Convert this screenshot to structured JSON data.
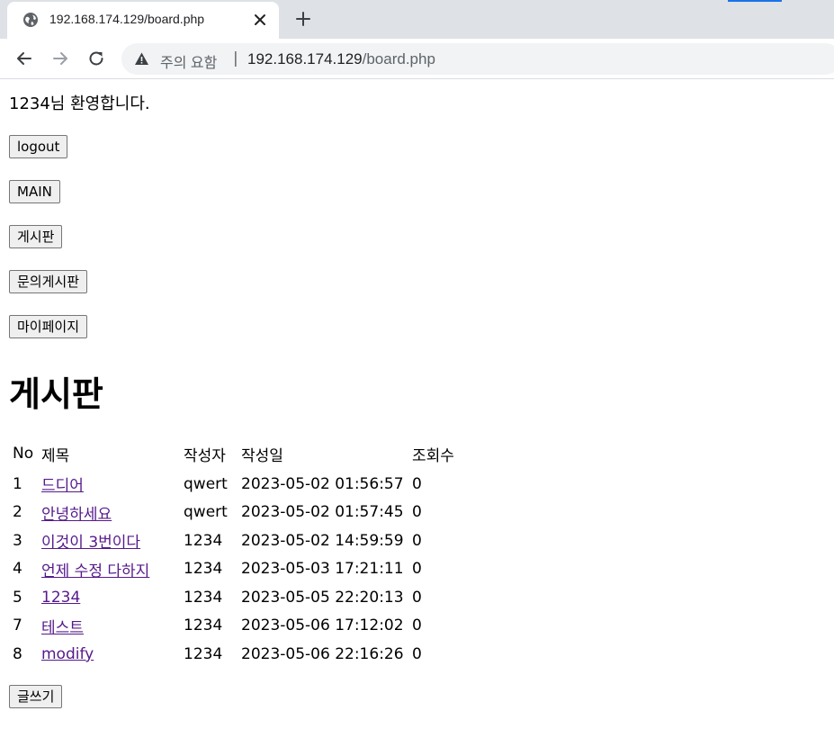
{
  "browser": {
    "tab_title": "192.168.174.129/board.php",
    "security_label": "주의 요함",
    "separator": "|",
    "url_host": "192.168.174.129",
    "url_path": "/board.php"
  },
  "page": {
    "welcome": "1234님 환영합니다.",
    "buttons": {
      "logout": "logout",
      "main": "MAIN",
      "board": "게시판",
      "qna": "문의게시판",
      "mypage": "마이페이지",
      "write": "글쓰기"
    },
    "heading": "게시판",
    "table": {
      "headers": [
        "No",
        "제목",
        "작성자",
        "작성일",
        "조회수"
      ],
      "rows": [
        {
          "no": "1",
          "title": "드디어",
          "writer": "qwert",
          "date": "2023-05-02 01:56:57",
          "views": "0"
        },
        {
          "no": "2",
          "title": "안녕하세요",
          "writer": "qwert",
          "date": "2023-05-02 01:57:45",
          "views": "0"
        },
        {
          "no": "3",
          "title": "이것이 3번이다",
          "writer": "1234",
          "date": "2023-05-02 14:59:59",
          "views": "0"
        },
        {
          "no": "4",
          "title": "언제 수정 다하지",
          "writer": "1234",
          "date": "2023-05-03 17:21:11",
          "views": "0"
        },
        {
          "no": "5",
          "title": "1234",
          "writer": "1234",
          "date": "2023-05-05 22:20:13",
          "views": "0"
        },
        {
          "no": "7",
          "title": "테스트",
          "writer": "1234",
          "date": "2023-05-06 17:12:02",
          "views": "0"
        },
        {
          "no": "8",
          "title": "modify",
          "writer": "1234",
          "date": "2023-05-06 22:16:26",
          "views": "0"
        }
      ]
    }
  }
}
